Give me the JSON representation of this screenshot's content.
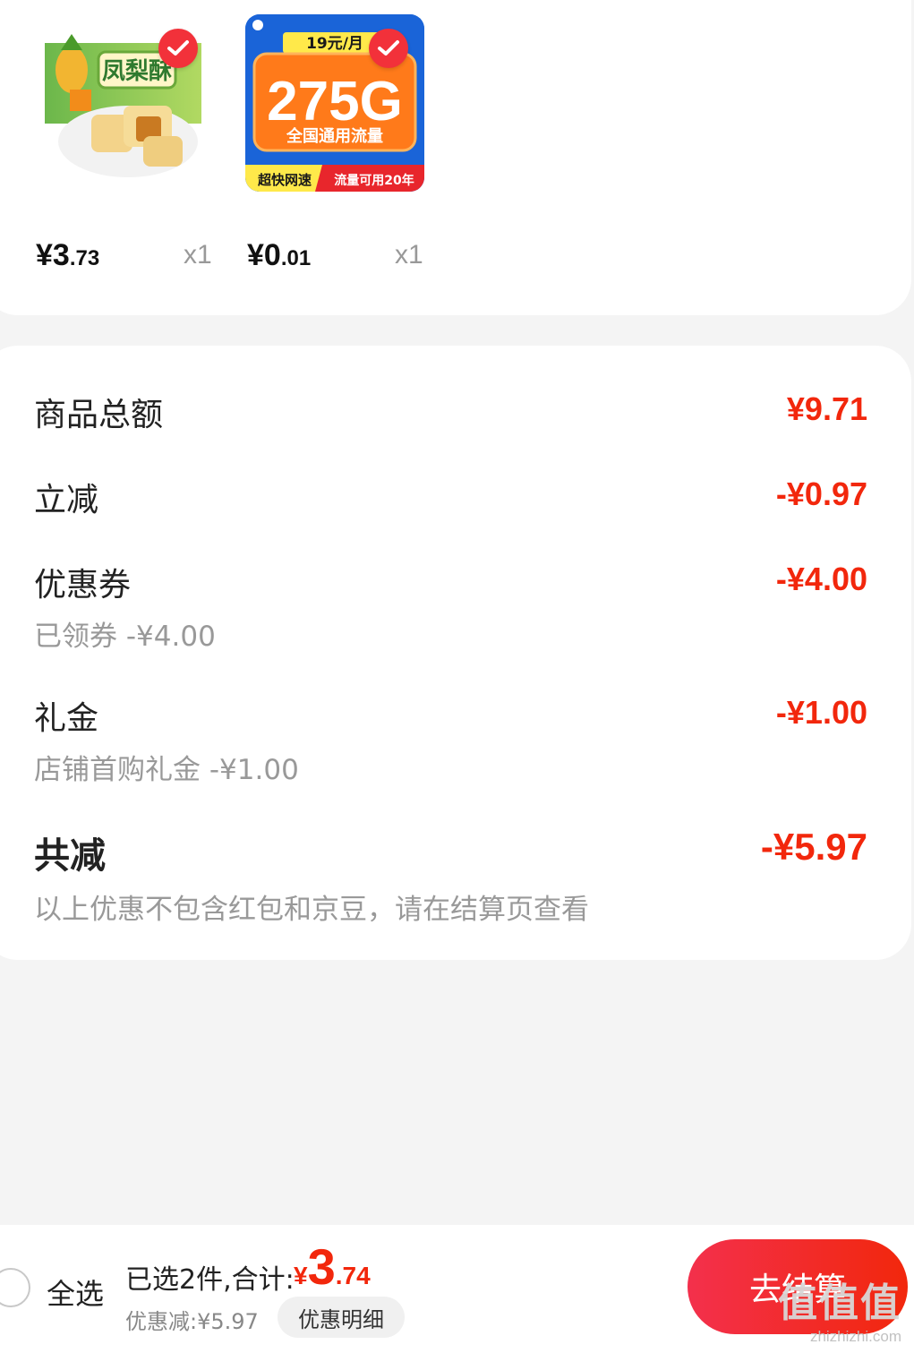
{
  "products": [
    {
      "name": "凤梨酥",
      "price_int": "¥3",
      "price_dec": ".73",
      "quantity": "x1",
      "badge_icon": "check-icon"
    },
    {
      "name": "275G 全国通用流量",
      "price_int": "¥0",
      "price_dec": ".01",
      "quantity": "x1",
      "badge_icon": "check-icon",
      "card": {
        "monthly": "19元/月",
        "headline": "275G",
        "subline": "全国通用流量",
        "left_tag": "超快网速",
        "right_tag": "流量可用20年"
      }
    }
  ],
  "summary": {
    "goods_total_label": "商品总额",
    "goods_total_value": "¥9.71",
    "instant_cut_label": "立减",
    "instant_cut_value": "-¥0.97",
    "coupon_label": "优惠券",
    "coupon_value": "-¥4.00",
    "coupon_sub": "已领券 -¥4.00",
    "gift_label": "礼金",
    "gift_value": "-¥1.00",
    "gift_sub": "店铺首购礼金 -¥1.00",
    "total_cut_label": "共减",
    "total_cut_value": "-¥5.97",
    "note": "以上优惠不包含红包和京豆，请在结算页查看"
  },
  "bottom_bar": {
    "select_all": "全选",
    "selected_text": "已选2件,合计:",
    "total_currency": "¥",
    "total_int": "3",
    "total_dec": ".74",
    "discount_text": "优惠减:¥5.97",
    "detail_button": "优惠明细",
    "checkout_button": "去结算"
  },
  "watermark": {
    "logo": "值值值",
    "url": "zhizhizhi.com"
  },
  "colors": {
    "accent": "#f2270c",
    "checkout_gradient_start": "#f3304c",
    "background": "#f4f4f4"
  }
}
